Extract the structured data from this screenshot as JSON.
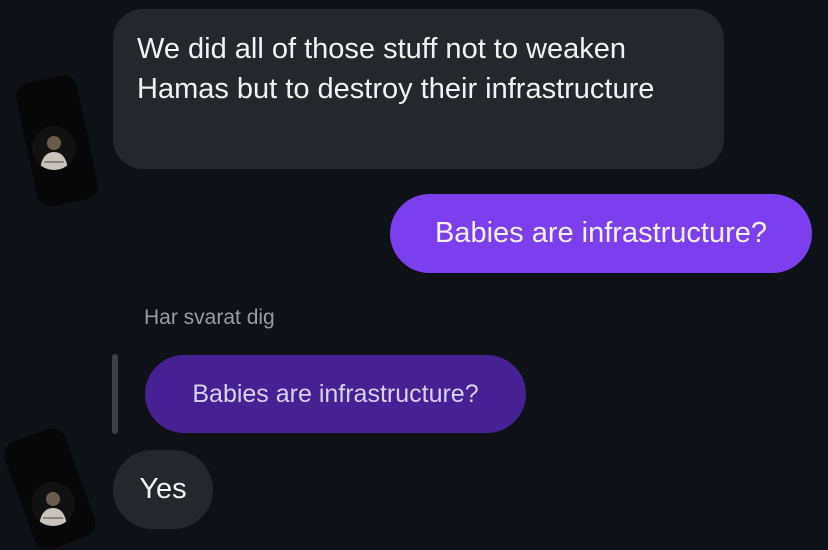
{
  "messages": {
    "incoming_1": {
      "text": "We did all of those stuff not to weaken Hamas but to destroy their infrastructure"
    },
    "outgoing_1": {
      "text": "Babies are infrastructure?"
    },
    "reply": {
      "header": "Har svarat dig",
      "quoted_text": "Babies are infrastructure?"
    },
    "incoming_2": {
      "text": "Yes"
    }
  },
  "colors": {
    "background": "#0e1115",
    "incoming_bubble": "#25272c",
    "outgoing_bubble": "#7c3fee",
    "quoted_bubble": "#452193"
  },
  "icons": {
    "avatar": "profile-avatar-icon"
  }
}
